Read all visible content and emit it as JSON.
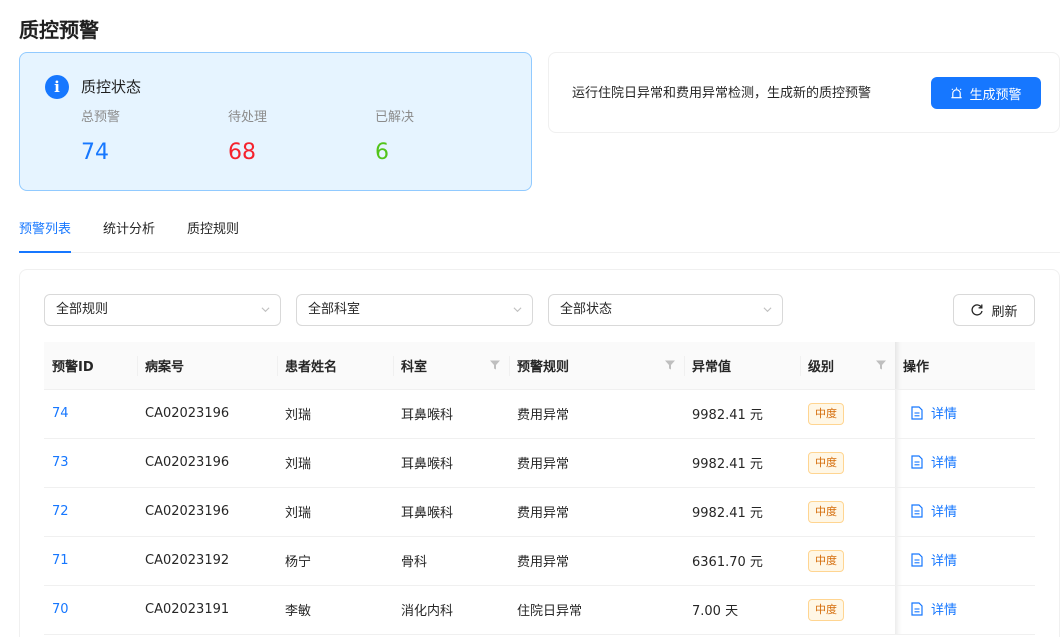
{
  "page": {
    "title": "质控预警"
  },
  "status": {
    "title": "质控状态",
    "stats": [
      {
        "label": "总预警",
        "value": "74",
        "color": "#1677ff"
      },
      {
        "label": "待处理",
        "value": "68",
        "color": "#f5222d"
      },
      {
        "label": "已解决",
        "value": "6",
        "color": "#52c41a"
      }
    ],
    "icon": "info-icon"
  },
  "action": {
    "text": "运行住院日异常和费用异常检测，生成新的质控预警",
    "button_label": "生成预警",
    "button_icon": "alarm-icon"
  },
  "tabs": [
    {
      "label": "预警列表",
      "active": true
    },
    {
      "label": "统计分析",
      "active": false
    },
    {
      "label": "质控规则",
      "active": false
    }
  ],
  "filters": {
    "rule": "全部规则",
    "dept": "全部科室",
    "status": "全部状态",
    "refresh_label": "刷新"
  },
  "table": {
    "columns": [
      "预警ID",
      "病案号",
      "患者姓名",
      "科室",
      "预警规则",
      "异常值",
      "级别",
      "操作"
    ],
    "rows": [
      {
        "id": "74",
        "case_no": "CA02023196",
        "name": "刘瑞",
        "dept": "耳鼻喉科",
        "rule": "费用异常",
        "value": "9982.41 元",
        "level": "中度",
        "action": "详情"
      },
      {
        "id": "73",
        "case_no": "CA02023196",
        "name": "刘瑞",
        "dept": "耳鼻喉科",
        "rule": "费用异常",
        "value": "9982.41 元",
        "level": "中度",
        "action": "详情"
      },
      {
        "id": "72",
        "case_no": "CA02023196",
        "name": "刘瑞",
        "dept": "耳鼻喉科",
        "rule": "费用异常",
        "value": "9982.41 元",
        "level": "中度",
        "action": "详情"
      },
      {
        "id": "71",
        "case_no": "CA02023192",
        "name": "杨宁",
        "dept": "骨科",
        "rule": "费用异常",
        "value": "6361.70 元",
        "level": "中度",
        "action": "详情"
      },
      {
        "id": "70",
        "case_no": "CA02023191",
        "name": "李敏",
        "dept": "消化内科",
        "rule": "住院日异常",
        "value": "7.00 天",
        "level": "中度",
        "action": "详情"
      }
    ]
  },
  "colors": {
    "primary": "#1677ff",
    "warning_tag": "#d46b08"
  }
}
